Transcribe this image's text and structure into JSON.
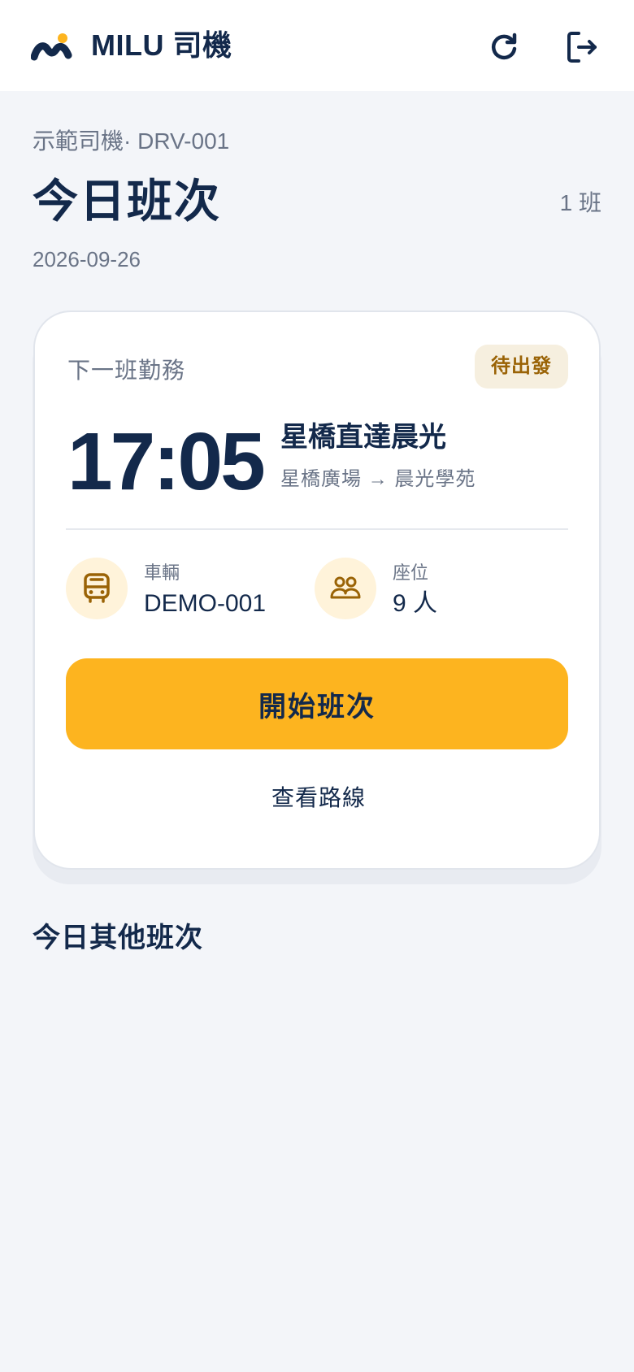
{
  "header": {
    "app_title": "MILU 司機",
    "logo_icon": "milu-logo",
    "refresh_icon": "refresh-icon",
    "logout_icon": "logout-icon",
    "brand_color": "#13294b",
    "accent_color": "#fdb41f"
  },
  "summary": {
    "driver": "示範司機· DRV-001",
    "title": "今日班次",
    "trip_count": "1 班",
    "date": "2026-09-26"
  },
  "next_trip": {
    "label": "下一班勤務",
    "status": "待出發",
    "departure_time": "17:05",
    "route_name": "星橋直達晨光",
    "route_path": "星橋廣場 → 晨光學苑",
    "vehicle": {
      "icon": "bus-icon",
      "label": "車輛",
      "value": "DEMO-001"
    },
    "seats": {
      "icon": "users-icon",
      "label": "座位",
      "value": "9 人"
    },
    "start_button": "開始班次",
    "view_route_link": "查看路線"
  },
  "other_trips": {
    "title": "今日其他班次",
    "items": []
  }
}
